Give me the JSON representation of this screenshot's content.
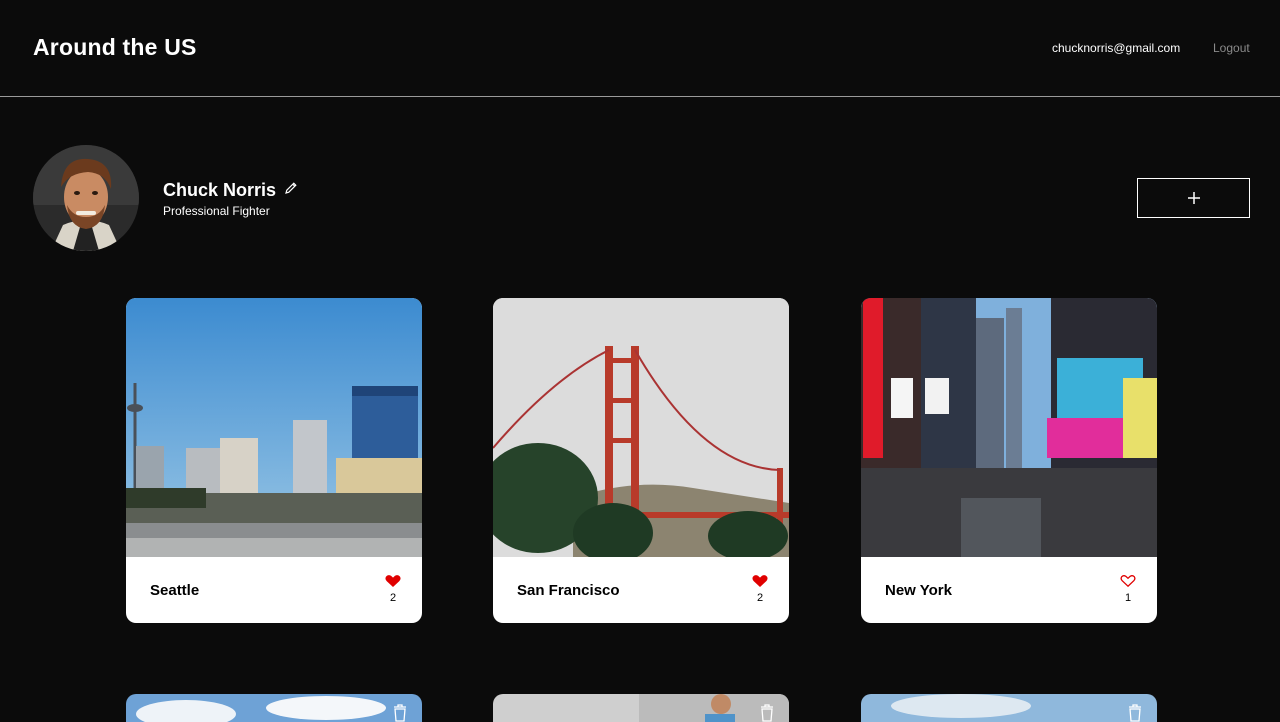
{
  "header": {
    "logo": "Around the US",
    "email": "chucknorris@gmail.com",
    "logout": "Logout"
  },
  "profile": {
    "name": "Chuck Norris",
    "about": "Professional Fighter",
    "add_icon": "plus-icon",
    "edit_icon": "pencil-icon"
  },
  "cards": [
    {
      "title": "Seattle",
      "likes": "2",
      "liked": true
    },
    {
      "title": "San Francisco",
      "likes": "2",
      "liked": true
    },
    {
      "title": "New York",
      "likes": "1",
      "liked": false
    }
  ],
  "colors": {
    "background": "#0b0b0b",
    "like_active": "#e00000",
    "card_bg": "#ffffff"
  }
}
